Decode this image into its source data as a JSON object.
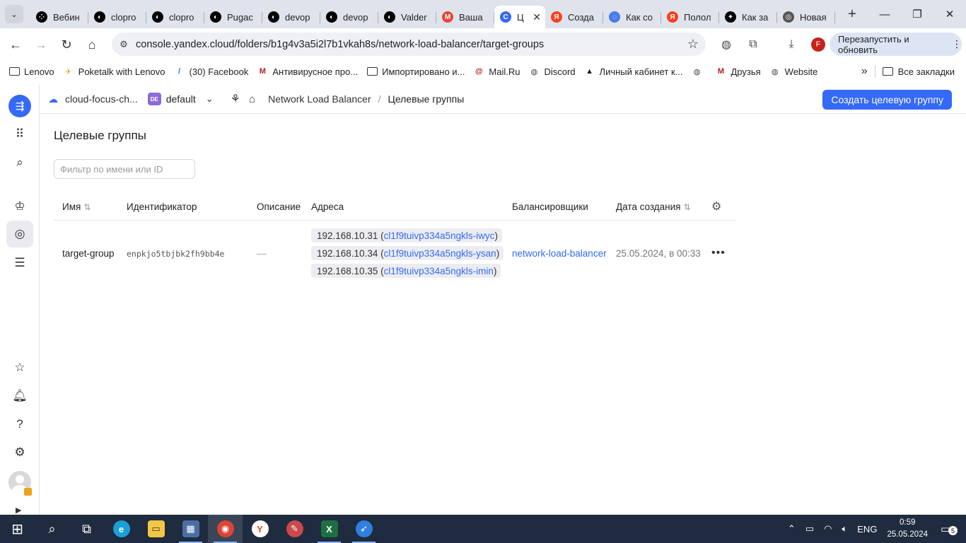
{
  "browser": {
    "tabs": [
      {
        "title": "Вебин",
        "icon": "netflix-icon",
        "color": "#000000"
      },
      {
        "title": "clopro",
        "icon": "github-icon",
        "color": "#000000"
      },
      {
        "title": "clopro",
        "icon": "github-icon",
        "color": "#000000"
      },
      {
        "title": "Pugac",
        "icon": "github-icon",
        "color": "#000000"
      },
      {
        "title": "devop",
        "icon": "github-icon",
        "color": "#000000"
      },
      {
        "title": "devop",
        "icon": "github-icon",
        "color": "#000000"
      },
      {
        "title": "Valder",
        "icon": "github-icon",
        "color": "#000000"
      },
      {
        "title": "Ваша",
        "icon": "gmail-icon",
        "color": "#ea4335"
      },
      {
        "title": "Ц",
        "icon": "yandex-cloud-icon",
        "color": "#3569f7",
        "active": true
      },
      {
        "title": "Созда",
        "icon": "yandex-icon",
        "color": "#fc3f1d"
      },
      {
        "title": "Как со",
        "icon": "alice-icon",
        "color": "#4b7bec"
      },
      {
        "title": "Полол",
        "icon": "yandex-icon",
        "color": "#fc3f1d"
      },
      {
        "title": "Как за",
        "icon": "plus-circle-icon",
        "color": "#000000"
      },
      {
        "title": "Новая",
        "icon": "globe-icon",
        "color": "#555555"
      }
    ],
    "url": "console.yandex.cloud/folders/b1g4v3a5i2l7b1vkah8s/network-load-balancer/target-groups",
    "profile_letter": "F",
    "restart_label": "Перезапустить и обновить",
    "bookmarks": [
      {
        "label": "Lenovo",
        "icon": "folder-icon"
      },
      {
        "label": "Poketalk with Lenovo",
        "icon": "poketalk-icon"
      },
      {
        "label": "(30) Facebook",
        "icon": "facebook-icon"
      },
      {
        "label": "Антивирусное про...",
        "icon": "mcafee-icon"
      },
      {
        "label": "Импортировано и...",
        "icon": "folder-icon"
      },
      {
        "label": "Mail.Ru",
        "icon": "mailru-icon"
      },
      {
        "label": "Discord",
        "icon": "globe-icon"
      },
      {
        "label": "Личный кабинет к...",
        "icon": "cabinet-icon"
      },
      {
        "label": "",
        "icon": "globe-icon"
      },
      {
        "label": "Друзья",
        "icon": "mcafee-icon"
      },
      {
        "label": "Website",
        "icon": "globe-icon"
      }
    ],
    "all_bookmarks_label": "Все закладки"
  },
  "topbar": {
    "cloud_name": "cloud-focus-ch...",
    "folder_badge": "DE",
    "folder_name": "default",
    "breadcrumb_service": "Network Load Balancer",
    "breadcrumb_current": "Целевые группы",
    "create_button": "Создать целевую группу"
  },
  "page": {
    "title": "Целевые группы",
    "filter_placeholder": "Фильтр по имени или ID",
    "columns": [
      "Имя",
      "Идентификатор",
      "Описание",
      "Адреса",
      "Балансировщики",
      "Дата создания"
    ],
    "rows": [
      {
        "name": "target-group",
        "id": "enpkjo5tbjbk2fh9bb4e",
        "description": "—",
        "addresses": [
          {
            "ip": "192.168.10.31",
            "instance": "cl1f9tuivp334a5ngkls-iwyc"
          },
          {
            "ip": "192.168.10.34",
            "instance": "cl1f9tuivp334a5ngkls-ysan"
          },
          {
            "ip": "192.168.10.35",
            "instance": "cl1f9tuivp334a5ngkls-imin"
          }
        ],
        "balancer": "network-load-balancer",
        "created": "25.05.2024, в 00:33"
      }
    ]
  },
  "taskbar": {
    "lang": "ENG",
    "time": "0:59",
    "date": "25.05.2024",
    "notifications": "5"
  },
  "colors": {
    "accent": "#3569f7",
    "taskbar": "#1f2b3e"
  }
}
